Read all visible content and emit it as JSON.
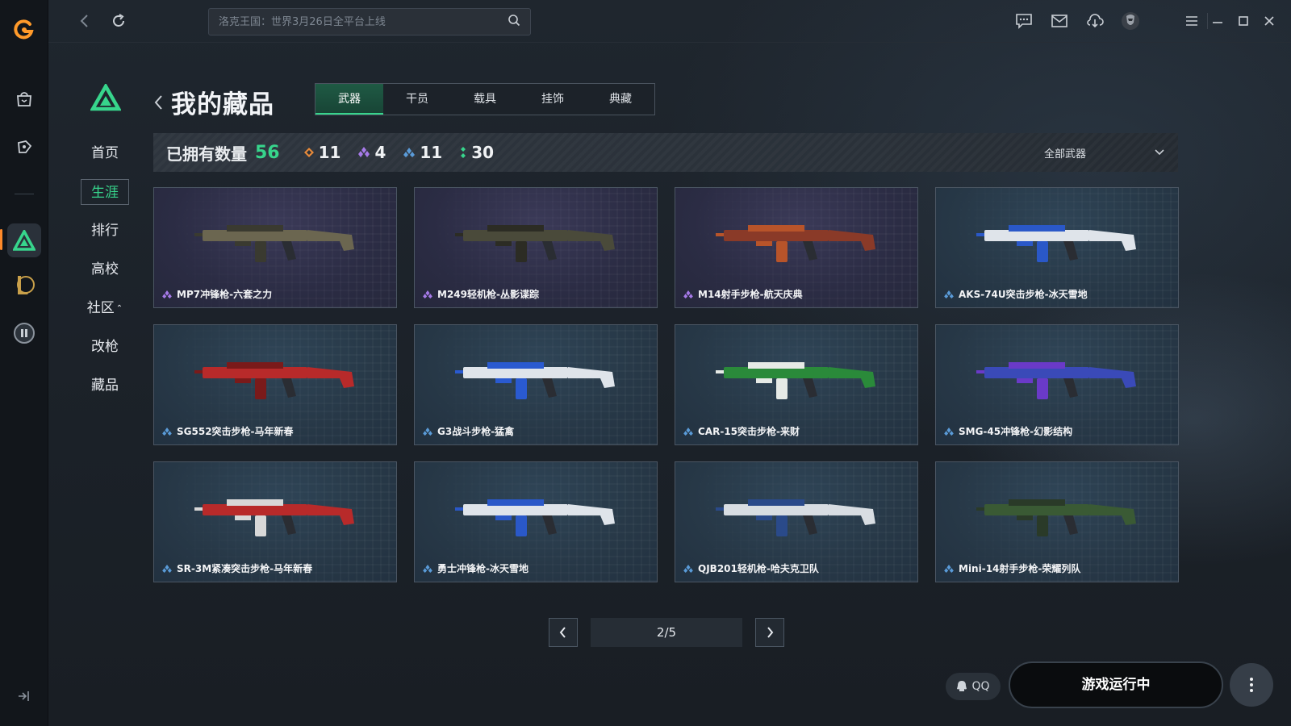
{
  "topbar": {
    "search_placeholder": "洛克王国：世界3月26日全平台上线"
  },
  "nav": {
    "items": [
      {
        "label": "首页",
        "active": false
      },
      {
        "label": "生涯",
        "active": true
      },
      {
        "label": "排行",
        "active": false
      },
      {
        "label": "高校",
        "active": false
      },
      {
        "label": "社区",
        "active": false
      },
      {
        "label": "改枪",
        "active": false
      },
      {
        "label": "藏品",
        "active": false
      }
    ]
  },
  "header": {
    "title": "我的藏品",
    "tabs": [
      "武器",
      "干员",
      "载具",
      "挂饰",
      "典藏"
    ],
    "active_tab": "武器"
  },
  "stats": {
    "owned_label": "已拥有数量",
    "owned_total": "56",
    "tiers": [
      {
        "icon": "orange-diamond-icon",
        "count": "11",
        "color": "#e88a3a"
      },
      {
        "icon": "purple-diamond-icon",
        "count": "4",
        "color": "#a67ae8"
      },
      {
        "icon": "blue-diamond-icon",
        "count": "11",
        "color": "#5a9bd8"
      },
      {
        "icon": "green-diamond-icon",
        "count": "30",
        "color": "#37d58c"
      }
    ],
    "filter": "全部武器"
  },
  "items": [
    {
      "name": "MP7冲锋枪-六套之力",
      "rarity": "purple"
    },
    {
      "name": "M249轻机枪-丛影谍踪",
      "rarity": "purple"
    },
    {
      "name": "M14射手步枪-航天庆典",
      "rarity": "purple"
    },
    {
      "name": "AKS-74U突击步枪-冰天雪地",
      "rarity": "blue"
    },
    {
      "name": "SG552突击步枪-马年新春",
      "rarity": "blue"
    },
    {
      "name": "G3战斗步枪-猛禽",
      "rarity": "blue"
    },
    {
      "name": "CAR-15突击步枪-来财",
      "rarity": "blue"
    },
    {
      "name": "SMG-45冲锋枪-幻影结构",
      "rarity": "blue"
    },
    {
      "name": "SR-3M紧凑突击步枪-马年新春",
      "rarity": "blue"
    },
    {
      "name": "勇士冲锋枪-冰天雪地",
      "rarity": "blue"
    },
    {
      "name": "QJB201轻机枪-哈夫克卫队",
      "rarity": "blue"
    },
    {
      "name": "Mini-14射手步枪-荣耀列队",
      "rarity": "blue"
    }
  ],
  "pagination": {
    "label": "2/5",
    "current": 2,
    "total": 5
  },
  "footer": {
    "qq_label": "QQ",
    "run_label": "游戏运行中"
  },
  "colors": {
    "accent": "#37d58c",
    "purple_rarity": "#a67ae8",
    "blue_rarity": "#5a9bd8"
  }
}
